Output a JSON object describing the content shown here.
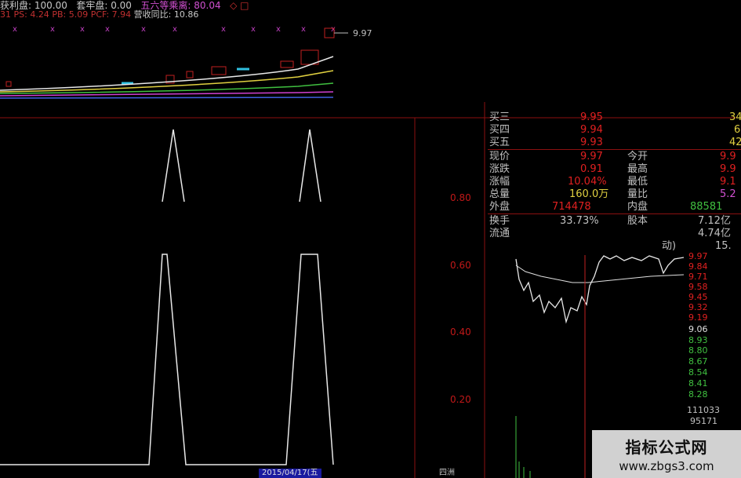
{
  "header": {
    "label_profit": "获利盘:",
    "value_profit": "100.00",
    "label_trap": "套牢盘:",
    "value_trap": "0.00",
    "label_five": "五六等乘离:",
    "value_five": "80.04",
    "icons": "◇ □",
    "row2_prefix": "31",
    "ps": "PS: 4.24",
    "pb": "PB: 5.09",
    "pcf": "PCF: 7.94",
    "revenue": "营收同比: 10.86"
  },
  "kline": {
    "price_tag": "9.97"
  },
  "indicator": {
    "y_labels": [
      "0.80",
      "0.60",
      "0.40",
      "0.20"
    ]
  },
  "quote_panel": {
    "rows": [
      {
        "l1": "买三",
        "v1": "9.95",
        "l2": "",
        "v2": "34"
      },
      {
        "l1": "买四",
        "v1": "9.94",
        "l2": "",
        "v2": "6"
      },
      {
        "l1": "买五",
        "v1": "9.93",
        "l2": "",
        "v2": "42"
      },
      {
        "l1": "现价",
        "v1": "9.97",
        "l2": "今开",
        "v2": "9.9"
      },
      {
        "l1": "涨跌",
        "v1": "0.91",
        "l2": "最高",
        "v2": "9.9"
      },
      {
        "l1": "涨幅",
        "v1": "10.04%",
        "l2": "最低",
        "v2": "9.1"
      },
      {
        "l1": "总量",
        "v1": "160.0万",
        "l2": "量比",
        "v2": "5.2"
      },
      {
        "l1": "外盘",
        "v1": "714478",
        "l2": "内盘",
        "v2": "88581"
      },
      {
        "l1": "换手",
        "v1": "33.73%",
        "l2": "股本",
        "v2": "7.12亿"
      },
      {
        "l1": "流通",
        "v1": "",
        "l2": "",
        "v2": "4.74亿"
      }
    ],
    "partial_label": "动)",
    "partial_value": "15."
  },
  "minute_chart": {
    "price_labels": [
      "9.97",
      "9.84",
      "9.71",
      "9.58",
      "9.45",
      "9.32",
      "9.19",
      "9.06",
      "8.93",
      "8.80",
      "8.67",
      "8.54",
      "8.41",
      "8.28"
    ],
    "vol_label": "111033",
    "vol_label2": "95171"
  },
  "footer": {
    "date_box": "2015/04/17(五",
    "bottom_label": "四洲"
  },
  "watermark": {
    "title": "指标公式网",
    "url": "www.zbgs3.com"
  }
}
